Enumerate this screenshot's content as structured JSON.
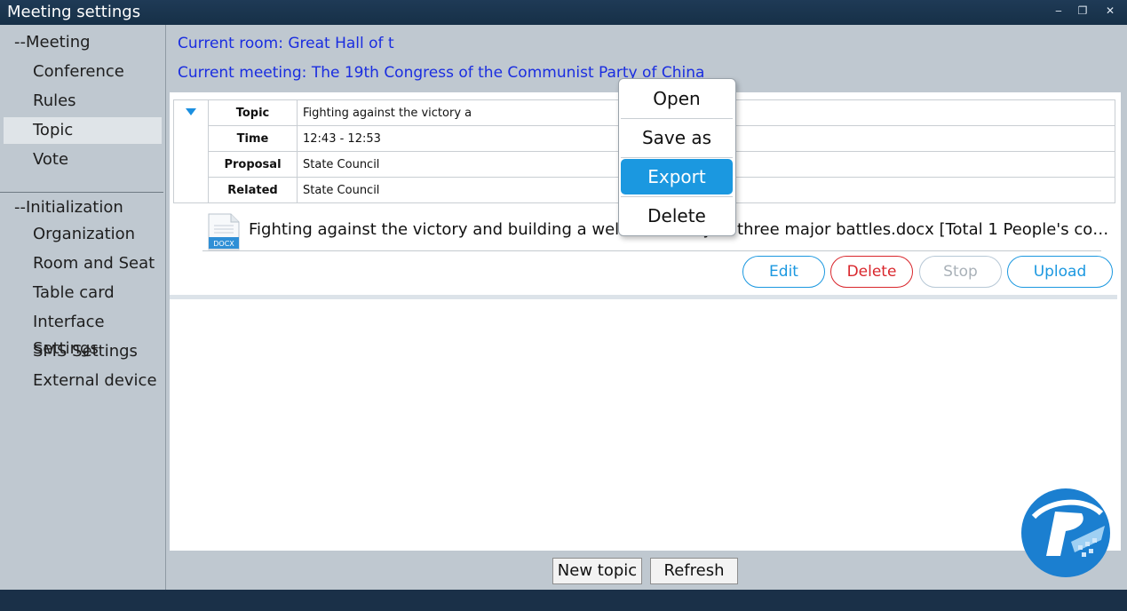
{
  "window": {
    "title": "Meeting settings",
    "controls": {
      "minimize": "‒",
      "restore": "❐",
      "close": "✕"
    }
  },
  "sidebar": {
    "meeting_group": "--Meeting",
    "meeting_items": [
      "Conference",
      "Rules",
      "Topic",
      "Vote"
    ],
    "init_group": "--Initialization",
    "init_items": [
      "Organization",
      "Room and Seat",
      "Table card",
      "Interface Settings",
      "SMS Settings",
      "External device"
    ]
  },
  "header": {
    "current_room": "Current room:  Great Hall of t",
    "current_meeting": "Current meeting:  The 19th Congress of the Communist Party of China"
  },
  "topic": {
    "rows": [
      {
        "label": "Topic",
        "value": "Fighting against the victory a"
      },
      {
        "label": "Time",
        "value": "12:43 - 12:53"
      },
      {
        "label": "Proposal",
        "value": "State Council"
      },
      {
        "label": "Related",
        "value": "State Council"
      }
    ],
    "file": {
      "icon_text": "DOCX",
      "name": "Fighting against the victory and building a well-off society in three major battles.docx   [Total 1 People's co…"
    }
  },
  "actions": {
    "edit": "Edit",
    "delete": "Delete",
    "stop": "Stop",
    "upload": "Upload"
  },
  "footer": {
    "new_topic": "New topic",
    "refresh": "Refresh"
  },
  "context_menu": {
    "items": [
      "Open",
      "Save as",
      "Export",
      "Delete"
    ],
    "highlighted": "Export"
  },
  "colors": {
    "accent": "#1b98e0",
    "link_blue": "#1a2de0",
    "delete_red": "#d9262c",
    "disabled": "#a9b1b8"
  }
}
